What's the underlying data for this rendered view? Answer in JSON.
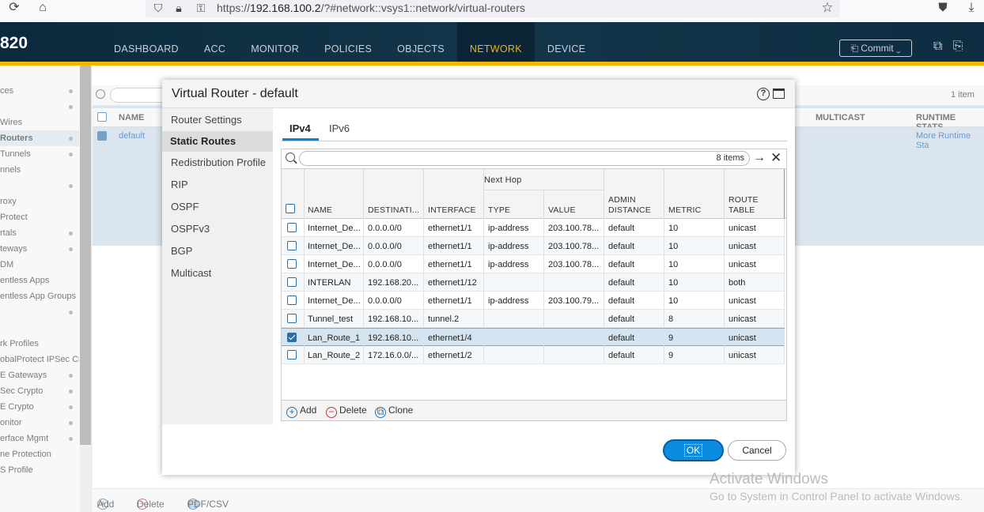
{
  "browser": {
    "url_prefix": "https://",
    "url_host": "192.168.100.2",
    "url_path": "/?#network::vsys1::network/virtual-routers"
  },
  "app": {
    "logo_fragment": "820",
    "tabs": [
      "DASHBOARD",
      "ACC",
      "MONITOR",
      "POLICIES",
      "OBJECTS",
      "NETWORK",
      "DEVICE"
    ],
    "active_tab": "NETWORK",
    "commit_label": "Commit ⌄"
  },
  "sidebar": {
    "items": [
      {
        "label": "ces",
        "dot": true
      },
      {
        "label": "",
        "dot": true
      },
      {
        "label": " Wires",
        "dot": false
      },
      {
        "label": " Routers",
        "dot": true,
        "active": true
      },
      {
        "label": "Tunnels",
        "dot": true
      },
      {
        "label": "nnels",
        "dot": false
      },
      {
        "label": "",
        "dot": true
      },
      {
        "label": "roxy",
        "dot": false
      },
      {
        "label": "Protect",
        "dot": false
      },
      {
        "label": "rtals",
        "dot": true
      },
      {
        "label": "teways",
        "dot": true
      },
      {
        "label": "DM",
        "dot": false
      },
      {
        "label": "entless Apps",
        "dot": false
      },
      {
        "label": "entless App Groups",
        "dot": false
      },
      {
        "label": "",
        "dot": true
      },
      {
        "label": "",
        "dot": false
      },
      {
        "label": "rk Profiles",
        "dot": false
      },
      {
        "label": "obalProtect IPSec Cry",
        "dot": false
      },
      {
        "label": "E Gateways",
        "dot": true
      },
      {
        "label": "Sec Crypto",
        "dot": true
      },
      {
        "label": "E Crypto",
        "dot": true
      },
      {
        "label": "onitor",
        "dot": true
      },
      {
        "label": "erface Mgmt",
        "dot": true
      },
      {
        "label": "ne Protection",
        "dot": false
      },
      {
        "label": "S Profile",
        "dot": false
      }
    ]
  },
  "main": {
    "item_count": "1 item",
    "col_name": "NAME",
    "col_multicast": "MULTICAST",
    "col_runtime": "RUNTIME STATS",
    "row_name": "default",
    "row_link": "More Runtime Sta",
    "bottom_add": "Add",
    "bottom_delete": "Delete",
    "bottom_pdf": "PDF/CSV"
  },
  "modal": {
    "title": "Virtual Router - default",
    "nav": [
      "Router Settings",
      "Static Routes",
      "Redistribution Profile",
      "RIP",
      "OSPF",
      "OSPFv3",
      "BGP",
      "Multicast"
    ],
    "active_nav": "Static Routes",
    "subtabs": [
      "IPv4",
      "IPv6"
    ],
    "active_subtab": "IPv4",
    "items_count": "8 items",
    "headers": {
      "next_hop": "Next Hop",
      "name": "NAME",
      "destination": "DESTINATI...",
      "interface": "INTERFACE",
      "type": "TYPE",
      "value": "VALUE",
      "admin_line1": "ADMIN",
      "admin_line2": "DISTANCE",
      "metric": "METRIC",
      "route_line1": "ROUTE",
      "route_line2": "TABLE"
    },
    "rows": [
      {
        "name": "Internet_De...",
        "destination": "0.0.0.0/0",
        "interface": "ethernet1/1",
        "type": "ip-address",
        "value": "203.100.78...",
        "admin": "default",
        "metric": "10",
        "route_table": "unicast",
        "checked": false
      },
      {
        "name": "Internet_De...",
        "destination": "0.0.0.0/0",
        "interface": "ethernet1/1",
        "type": "ip-address",
        "value": "203.100.78...",
        "admin": "default",
        "metric": "10",
        "route_table": "unicast",
        "checked": false
      },
      {
        "name": "Internet_De...",
        "destination": "0.0.0.0/0",
        "interface": "ethernet1/1",
        "type": "ip-address",
        "value": "203.100.78...",
        "admin": "default",
        "metric": "10",
        "route_table": "unicast",
        "checked": false
      },
      {
        "name": "INTERLAN",
        "destination": "192.168.20...",
        "interface": "ethernet1/12",
        "type": "",
        "value": "",
        "admin": "default",
        "metric": "10",
        "route_table": "both",
        "checked": false
      },
      {
        "name": "Internet_De...",
        "destination": "0.0.0.0/0",
        "interface": "ethernet1/1",
        "type": "ip-address",
        "value": "203.100.79...",
        "admin": "default",
        "metric": "10",
        "route_table": "unicast",
        "checked": false
      },
      {
        "name": "Tunnel_test",
        "destination": "192.168.10...",
        "interface": "tunnel.2",
        "type": "",
        "value": "",
        "admin": "default",
        "metric": "8",
        "route_table": "unicast",
        "checked": false
      },
      {
        "name": "Lan_Route_1",
        "destination": "192.168.10...",
        "interface": "ethernet1/4",
        "type": "",
        "value": "",
        "admin": "default",
        "metric": "9",
        "route_table": "unicast",
        "checked": true
      },
      {
        "name": "Lan_Route_2",
        "destination": "172.16.0.0/...",
        "interface": "ethernet1/2",
        "type": "",
        "value": "",
        "admin": "default",
        "metric": "9",
        "route_table": "unicast",
        "checked": false
      }
    ],
    "footer": {
      "add": "Add",
      "delete": "Delete",
      "clone": "Clone"
    },
    "ok_label": "OK",
    "cancel_label": "Cancel"
  },
  "watermark": {
    "line1": "Activate Windows",
    "line2": "Go to System in Control Panel to activate Windows."
  },
  "colors": {
    "accent": "#f0b800",
    "nav_bg": "#0c2a3e",
    "primary": "#0a8de0",
    "link": "#1a65b0"
  }
}
